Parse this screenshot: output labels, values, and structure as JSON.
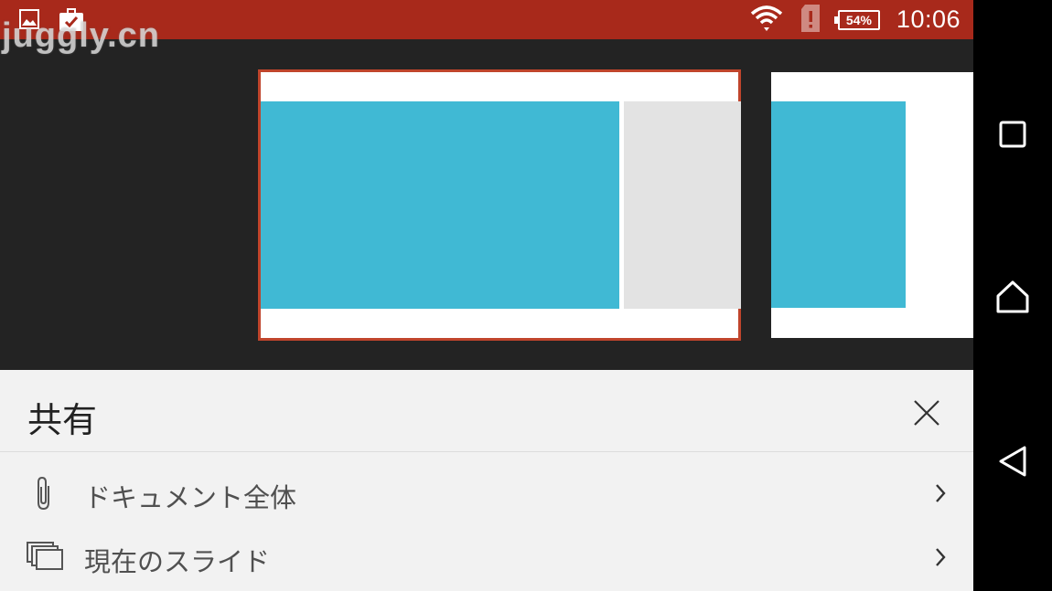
{
  "status_bar": {
    "time": "10:06",
    "battery": "54%",
    "icons": [
      "image-icon",
      "briefcase-check-icon",
      "wifi-icon",
      "sim-alert-icon",
      "battery-icon"
    ],
    "background": "#a8291b"
  },
  "watermark": "juggly.cn",
  "slides": {
    "accent": "#c0452c",
    "shape_color": "#40b9d4",
    "secondary_shape_color": "#e3e3e3"
  },
  "share": {
    "title": "共有",
    "items": [
      {
        "label": "ドキュメント全体",
        "icon": "paperclip-icon"
      },
      {
        "label": "現在のスライド",
        "icon": "slides-icon"
      }
    ]
  },
  "nav_bar": {
    "icons": [
      "recents-icon",
      "home-icon",
      "back-icon"
    ]
  }
}
